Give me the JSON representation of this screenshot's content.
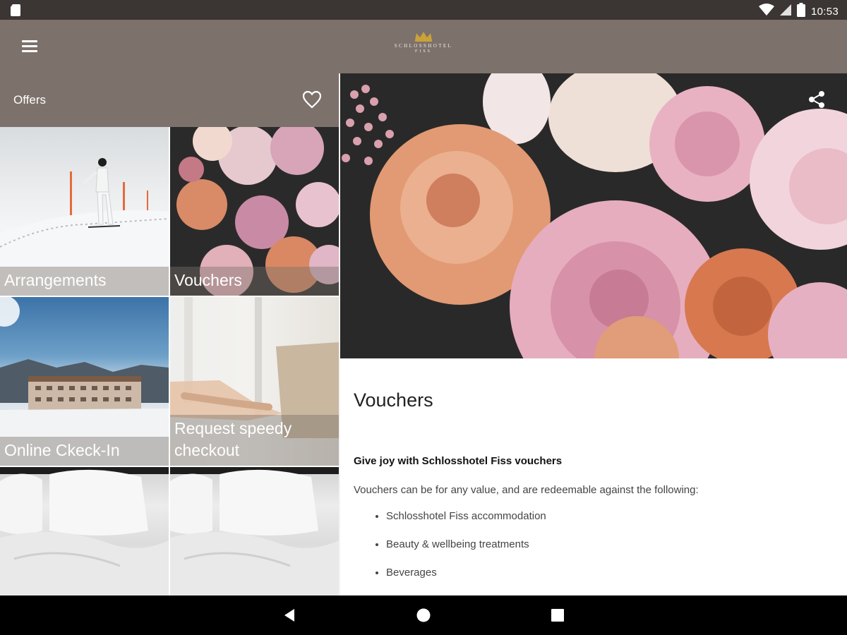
{
  "status_bar": {
    "time": "10:53",
    "icons": [
      "sim-card-icon",
      "wifi-icon",
      "cell-signal-icon",
      "battery-icon"
    ]
  },
  "app_bar": {
    "menu_icon": "hamburger-menu-icon",
    "logo_line1": "SCHLOSSHOTEL",
    "logo_line2": "FISS",
    "logo_color": "#c9a23a"
  },
  "colors": {
    "bar": "#7c716b",
    "status": "#3b3533"
  },
  "offers": {
    "title": "Offers",
    "favorite_icon": "heart-outline-icon",
    "tiles": [
      {
        "label": "Arrangements"
      },
      {
        "label": "Vouchers"
      },
      {
        "label": "Online Ckeck-In"
      },
      {
        "label": "Request speedy checkout"
      },
      {
        "label": ""
      },
      {
        "label": ""
      }
    ]
  },
  "detail": {
    "share_icon": "share-icon",
    "title": "Vouchers",
    "subtitle": "Give joy with Schlosshotel Fiss vouchers",
    "intro": "Vouchers can be for any value, and are redeemable against the following:",
    "items": [
      "Schlosshotel Fiss accommodation",
      "Beauty & wellbeing treatments",
      "Beverages"
    ]
  },
  "nav_bar": {
    "buttons": [
      "back-icon",
      "home-icon",
      "recents-icon"
    ]
  }
}
